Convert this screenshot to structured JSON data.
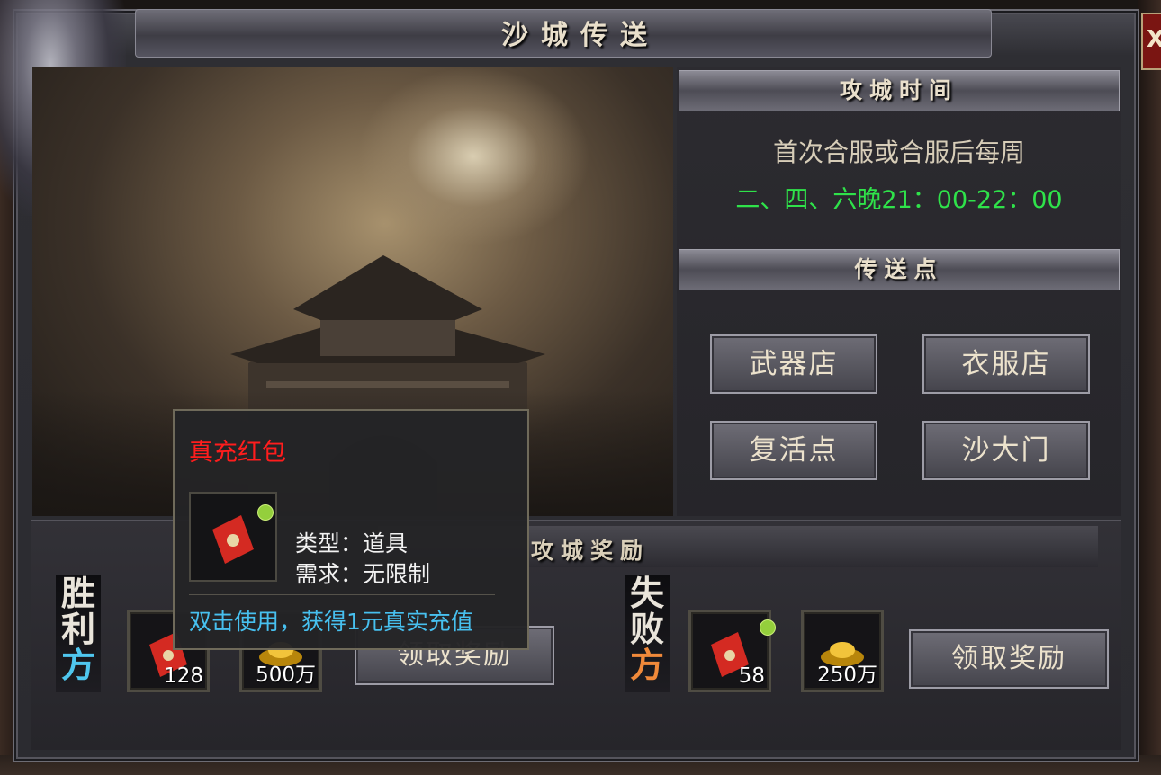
{
  "window": {
    "title": "沙城传送",
    "close_label": "X"
  },
  "siege_time": {
    "heading": "攻城时间",
    "line1": "首次合服或合服后每周",
    "line2": "二、四、六晚21：00-22：00"
  },
  "teleport": {
    "heading": "传送点",
    "buttons": [
      "武器店",
      "衣服店",
      "复活点",
      "沙大门"
    ]
  },
  "rewards": {
    "heading": "攻城奖励",
    "winner": {
      "label": "胜利方",
      "items": [
        {
          "icon": "red-envelope-icon",
          "count": "128"
        },
        {
          "icon": "gold-ingot-icon",
          "count": "500万"
        }
      ],
      "claim_label": "领取奖励"
    },
    "loser": {
      "label": "失败方",
      "items": [
        {
          "icon": "red-envelope-icon",
          "count": "58"
        },
        {
          "icon": "gold-ingot-icon",
          "count": "250万"
        }
      ],
      "claim_label": "领取奖励"
    }
  },
  "tooltip": {
    "name": "真充红包",
    "type_line": "类型：道具",
    "require_line": "需求：无限制",
    "use_line": "双击使用，获得1元真实充值"
  },
  "colors": {
    "time_green": "#2fe24a",
    "tooltip_name_red": "#ff1d1d",
    "tooltip_use_blue": "#47c0ef",
    "winner_accent": "#4fc6ee",
    "loser_accent": "#f0893a"
  }
}
